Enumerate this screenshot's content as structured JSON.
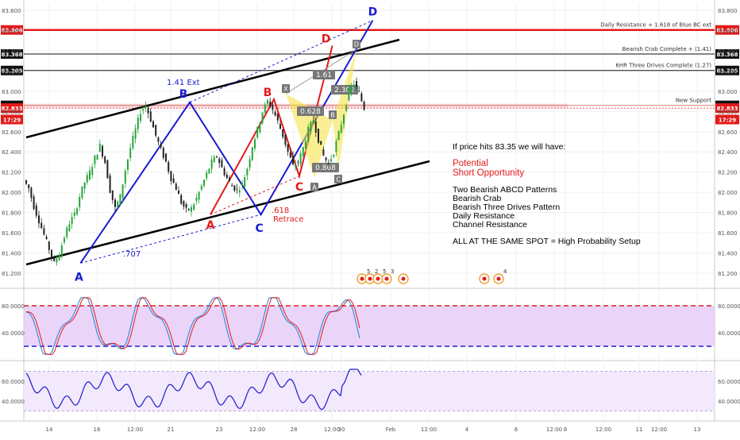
{
  "chart_data": {
    "type": "line",
    "price_panel": {
      "ylim": [
        81.1,
        83.9
      ],
      "y_ticks": [
        "83.800",
        "83.600",
        "83.400",
        "83.200",
        "83.000",
        "82.800",
        "82.600",
        "82.400",
        "82.200",
        "82.000",
        "81.800",
        "81.600",
        "81.400",
        "81.200"
      ],
      "series": [
        {
          "x": 0,
          "y": 82.12
        },
        {
          "x": 2,
          "y": 82.04
        },
        {
          "x": 4,
          "y": 81.86
        },
        {
          "x": 6,
          "y": 81.72
        },
        {
          "x": 8,
          "y": 81.58
        },
        {
          "x": 10,
          "y": 81.44
        },
        {
          "x": 12,
          "y": 81.3
        },
        {
          "x": 14,
          "y": 81.4
        },
        {
          "x": 16,
          "y": 81.56
        },
        {
          "x": 18,
          "y": 81.7
        },
        {
          "x": 20,
          "y": 81.78
        },
        {
          "x": 22,
          "y": 81.96
        },
        {
          "x": 24,
          "y": 82.1
        },
        {
          "x": 26,
          "y": 82.2
        },
        {
          "x": 28,
          "y": 82.34
        },
        {
          "x": 30,
          "y": 82.46
        },
        {
          "x": 32,
          "y": 82.3
        },
        {
          "x": 34,
          "y": 82.02
        },
        {
          "x": 36,
          "y": 81.84
        },
        {
          "x": 38,
          "y": 81.96
        },
        {
          "x": 40,
          "y": 82.22
        },
        {
          "x": 42,
          "y": 82.44
        },
        {
          "x": 44,
          "y": 82.62
        },
        {
          "x": 46,
          "y": 82.8
        },
        {
          "x": 48,
          "y": 82.86
        },
        {
          "x": 50,
          "y": 82.72
        },
        {
          "x": 52,
          "y": 82.56
        },
        {
          "x": 54,
          "y": 82.42
        },
        {
          "x": 56,
          "y": 82.3
        },
        {
          "x": 58,
          "y": 82.14
        },
        {
          "x": 60,
          "y": 82.04
        },
        {
          "x": 62,
          "y": 81.9
        },
        {
          "x": 64,
          "y": 81.82
        },
        {
          "x": 66,
          "y": 81.84
        },
        {
          "x": 68,
          "y": 81.94
        },
        {
          "x": 70,
          "y": 82.06
        },
        {
          "x": 72,
          "y": 82.18
        },
        {
          "x": 74,
          "y": 82.3
        },
        {
          "x": 76,
          "y": 82.36
        },
        {
          "x": 78,
          "y": 82.24
        },
        {
          "x": 80,
          "y": 82.14
        },
        {
          "x": 82,
          "y": 82.06
        },
        {
          "x": 84,
          "y": 82.02
        },
        {
          "x": 86,
          "y": 82.08
        },
        {
          "x": 88,
          "y": 82.24
        },
        {
          "x": 90,
          "y": 82.46
        },
        {
          "x": 92,
          "y": 82.62
        },
        {
          "x": 94,
          "y": 82.8
        },
        {
          "x": 96,
          "y": 82.9
        },
        {
          "x": 98,
          "y": 82.82
        },
        {
          "x": 100,
          "y": 82.7
        },
        {
          "x": 102,
          "y": 82.56
        },
        {
          "x": 104,
          "y": 82.4
        },
        {
          "x": 106,
          "y": 82.26
        },
        {
          "x": 108,
          "y": 82.3
        },
        {
          "x": 110,
          "y": 82.44
        },
        {
          "x": 112,
          "y": 82.62
        },
        {
          "x": 114,
          "y": 82.72
        },
        {
          "x": 116,
          "y": 82.52
        },
        {
          "x": 118,
          "y": 82.36
        },
        {
          "x": 120,
          "y": 82.28
        },
        {
          "x": 122,
          "y": 82.4
        },
        {
          "x": 124,
          "y": 82.58
        },
        {
          "x": 126,
          "y": 82.78
        },
        {
          "x": 128,
          "y": 83.0
        },
        {
          "x": 130,
          "y": 83.08
        },
        {
          "x": 132,
          "y": 82.98
        },
        {
          "x": 134,
          "y": 82.83
        }
      ],
      "price_labels": [
        {
          "text": "83.606",
          "value": 83.606,
          "tone": "red"
        },
        {
          "text": "83.368",
          "value": 83.368,
          "tone": "black"
        },
        {
          "text": "83.205",
          "value": 83.205,
          "tone": "black"
        },
        {
          "text": "82.860",
          "value": 82.86,
          "tone": "black"
        },
        {
          "text": "82.833",
          "value": 82.833,
          "tone": "red"
        },
        {
          "text": "17:29",
          "value": 82.72,
          "tone": "red"
        }
      ],
      "level_labels": [
        {
          "text": "Daily Resistance + 1.618 of Blue BC ext",
          "value": 83.606
        },
        {
          "text": "Bearish Crab Complete + (1.41)",
          "value": 83.368
        },
        {
          "text": "6HR Three Drives Complete (1.27)",
          "value": 83.205
        },
        {
          "text": "New Support",
          "value": 82.86
        }
      ],
      "pattern_points_blue": [
        {
          "label": "A",
          "x": 12,
          "y": 81.3
        },
        {
          "label": "B",
          "x": 55,
          "y": 82.89
        },
        {
          "label": "C",
          "x": 83,
          "y": 81.78
        },
        {
          "label": "D",
          "x": 127,
          "y": 83.7
        }
      ],
      "pattern_points_red": [
        {
          "label": "A",
          "x": 60,
          "y": 81.78
        },
        {
          "label": "B",
          "x": 85,
          "y": 82.92
        },
        {
          "label": "C",
          "x": 95,
          "y": 82.16
        },
        {
          "label": "D",
          "x": 108,
          "y": 83.45
        }
      ],
      "crab_labels": [
        "X",
        "A",
        "B",
        "C",
        "D"
      ],
      "ratio_labels": [
        "1.61",
        "2.302",
        "0.628",
        "0.868"
      ],
      "annotations": [
        "1.41 Ext",
        ".707",
        ".618",
        "Retrace"
      ]
    },
    "oscillator_1": {
      "y_ticks": [
        "80.0000",
        "40.0000"
      ],
      "upper": 80,
      "lower": 20
    },
    "oscillator_2": {
      "y_ticks": [
        "60.0000",
        "40.0000"
      ],
      "upper": 70,
      "lower": 30
    },
    "x_ticks": [
      "14",
      "16",
      "12:00",
      "21",
      "23",
      "12:00",
      "28",
      "12:00",
      "30",
      "Feb",
      "12:00",
      "4",
      "6",
      "12:00",
      "8",
      "12:00",
      "11",
      "12:00",
      "13"
    ],
    "event_labels": [
      "5",
      "2",
      "5",
      "3",
      "4"
    ]
  },
  "note": {
    "heading": "If price hits 83.35 we will have:",
    "potential_1": "Potential",
    "potential_2": "Short Opportunity",
    "lines": [
      "Two Bearish ABCD Patterns",
      "Bearish Crab",
      "Bearish Three Drives Pattern",
      "Daily Resistance",
      "Channel Resistance"
    ],
    "summary": "ALL AT THE SAME SPOT = High Probability Setup"
  }
}
